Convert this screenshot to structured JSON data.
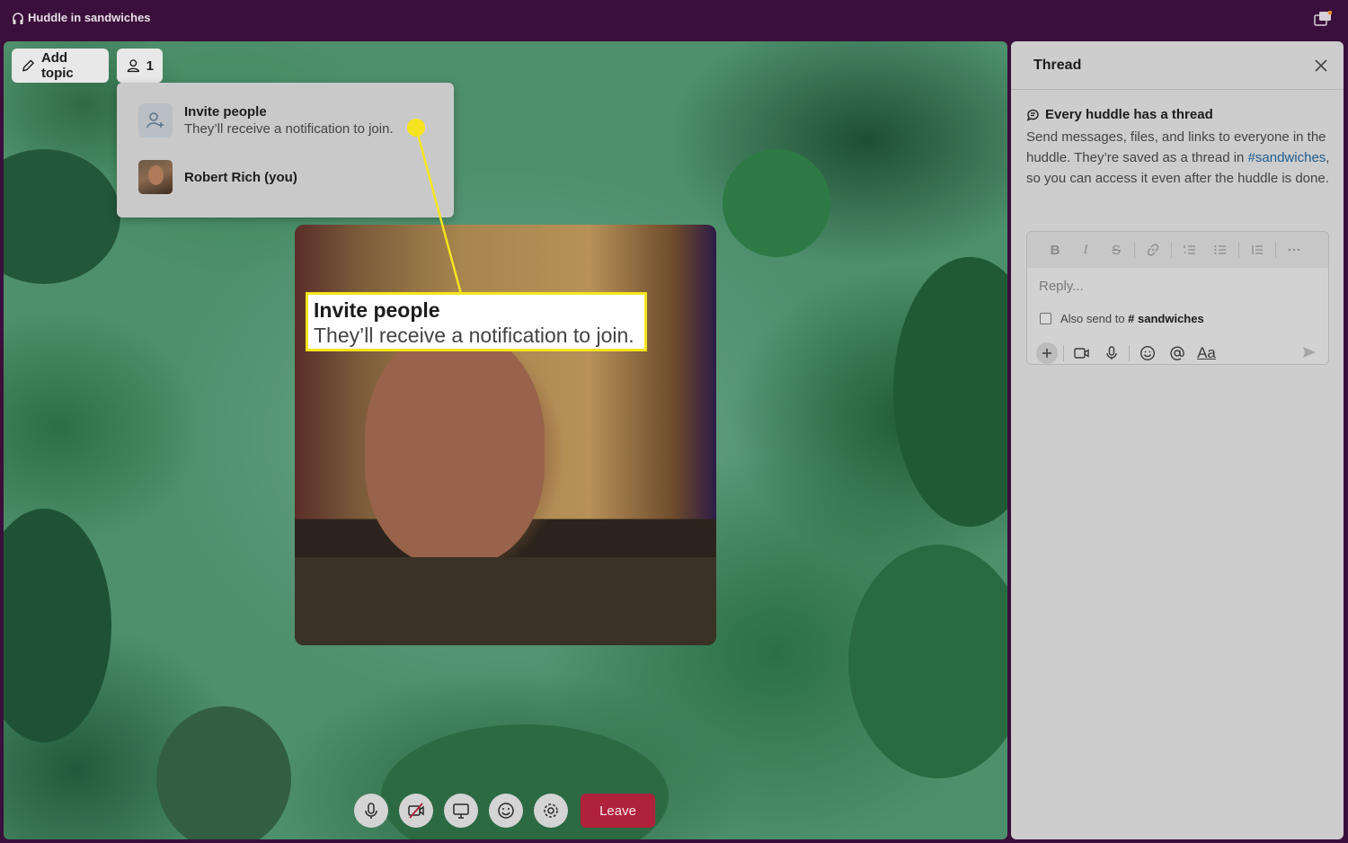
{
  "window": {
    "title": "Huddle in sandwiches"
  },
  "stage": {
    "add_topic_label": "Add topic",
    "participant_count": "1",
    "dropdown": {
      "invite_title": "Invite people",
      "invite_subtitle": "They’ll receive a notification to join.",
      "member_name": "Robert Rich (you)"
    },
    "callout": {
      "title": "Invite people",
      "subtitle": "They’ll receive a notification to join."
    },
    "controls": {
      "icons": [
        "microphone-icon",
        "camera-off-icon",
        "screen-share-icon",
        "emoji-icon",
        "settings-icon"
      ],
      "leave_label": "Leave"
    }
  },
  "thread": {
    "title": "Thread",
    "info_title": "Every huddle has a thread",
    "info_body_before": "Send messages, files, and links to everyone in the huddle. They’re saved as a thread in ",
    "info_channel_link": "#sandwiches",
    "info_body_after": ", so you can access it even after the huddle is done.",
    "composer": {
      "format_buttons": [
        "B",
        "I",
        "S",
        "link",
        "ordered-list",
        "bulleted-list",
        "blockquote",
        "more"
      ],
      "reply_placeholder": "Reply...",
      "also_send_prefix": "Also send to",
      "also_send_channel": "# sandwiches",
      "aa_label": "Aa"
    }
  },
  "colors": {
    "titlebar": "#3b0f3b",
    "leave_button": "#b0213c",
    "callout_border": "#f5e41f",
    "link": "#1d5d93"
  }
}
